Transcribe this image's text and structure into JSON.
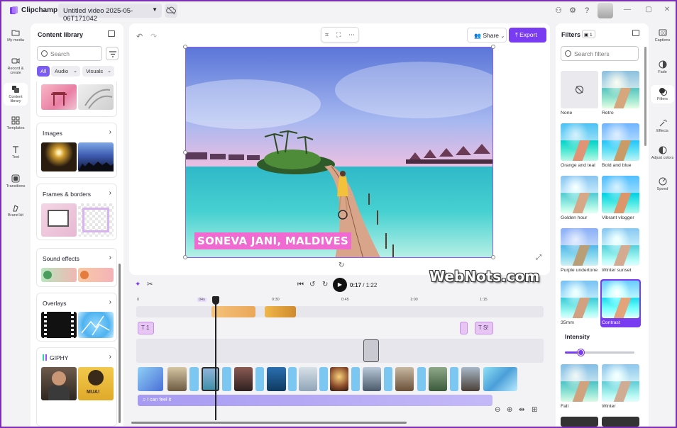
{
  "app": {
    "name": "Clipchamp",
    "title": "Untitled video 2025-05-06T171042"
  },
  "left_nav": [
    {
      "label": "My media",
      "icon": "folder-icon"
    },
    {
      "label": "Record & create",
      "icon": "camera-icon"
    },
    {
      "label": "Content library",
      "icon": "library-icon",
      "active": true
    },
    {
      "label": "Templates",
      "icon": "templates-icon"
    },
    {
      "label": "Text",
      "icon": "text-icon"
    },
    {
      "label": "Transitions",
      "icon": "transitions-icon"
    },
    {
      "label": "Brand kit",
      "icon": "brand-kit-icon"
    }
  ],
  "library": {
    "title": "Content library",
    "search_placeholder": "Search",
    "chips": [
      "All",
      "Audio",
      "Visuals"
    ],
    "sections": [
      "Images",
      "Frames & borders",
      "Sound effects",
      "Overlays",
      "GIPHY"
    ],
    "giphy_tag": "MUA!"
  },
  "toolbar": {
    "share": "Share",
    "export": "Export"
  },
  "preview": {
    "caption": "SONEVA JANI, MALDIVES"
  },
  "watermark": "WebNots.com",
  "playback": {
    "current": "0:17",
    "total": "/ 1:22"
  },
  "ruler": {
    "playhead_label": "04s",
    "ticks": [
      "0",
      "0:30",
      "0:45",
      "1:00",
      "1:15"
    ]
  },
  "timeline": {
    "text_clip_1": "1",
    "text_clip_2": "S!",
    "audio_clip": "I can feel it"
  },
  "filters_panel": {
    "title": "Filters",
    "count": "1",
    "search_placeholder": "Search filters",
    "items": [
      "None",
      "Retro",
      "Orange and teal",
      "Bold and blue",
      "Golden hour",
      "Vibrant vlogger",
      "Purple undertone",
      "Winter sunset",
      "35mm",
      "Contrast",
      "Fall",
      "Winter"
    ],
    "selected": "Contrast",
    "intensity_label": "Intensity",
    "intensity_level": 0.22
  },
  "right_nav": [
    {
      "label": "Captions",
      "icon": "captions-icon"
    },
    {
      "label": "Fade",
      "icon": "fade-icon"
    },
    {
      "label": "Filters",
      "icon": "filters-icon",
      "active": true
    },
    {
      "label": "Effects",
      "icon": "effects-icon"
    },
    {
      "label": "Adjust colors",
      "icon": "adjust-colors-icon"
    },
    {
      "label": "Speed",
      "icon": "speed-icon"
    }
  ],
  "colors": {
    "accent": "#7a3cf0",
    "caption_bg": "#f06ad2",
    "frame": "#7b2fb5"
  }
}
